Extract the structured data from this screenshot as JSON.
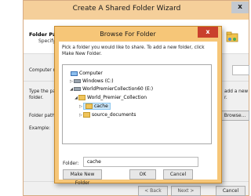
{
  "wizard": {
    "title": "Create A Shared Folder Wizard",
    "close_label": "x",
    "header_title": "Folder Path",
    "header_subtitle": "Specify",
    "computer_name_label": "Computer na",
    "type_path_label_1": "Type the pa",
    "type_path_label_2": "folder.",
    "new_folder_hint_1": "add a new",
    "new_folder_hint_2": "r.",
    "folder_path_label": "Folder path:",
    "example_label": "Example:",
    "browse_label": "Browse...",
    "back_label": "< Back",
    "next_label": "Next >",
    "cancel_label": "Cancel"
  },
  "dialog": {
    "title": "Browse For Folder",
    "close_label": "x",
    "instructions": "Pick a folder you would like to share. To add a new folder, click Make New Folder.",
    "tree": [
      {
        "label": "Computer",
        "icon": "computer-icon",
        "arrow": ""
      },
      {
        "label": "Windows (C:)",
        "icon": "drive-icon",
        "arrow": "▷"
      },
      {
        "label": "WorldPremierCollection60 (E:)",
        "icon": "drive-icon",
        "arrow": "◢"
      },
      {
        "label": "World_Premier_Collection",
        "icon": "folder-icon",
        "arrow": "◢"
      },
      {
        "label": "cache",
        "icon": "folder-icon",
        "arrow": "▷",
        "selected": true
      },
      {
        "label": "source_documents",
        "icon": "folder-icon",
        "arrow": "▷"
      }
    ],
    "folder_label": "Folder:",
    "folder_value": "cache",
    "make_new_folder_label": "Make New Folder",
    "ok_label": "OK",
    "cancel_label": "Cancel"
  },
  "colors": {
    "title_bar": "#f6c678",
    "close_button": "#c9402c",
    "selection": "#cce6f8"
  }
}
